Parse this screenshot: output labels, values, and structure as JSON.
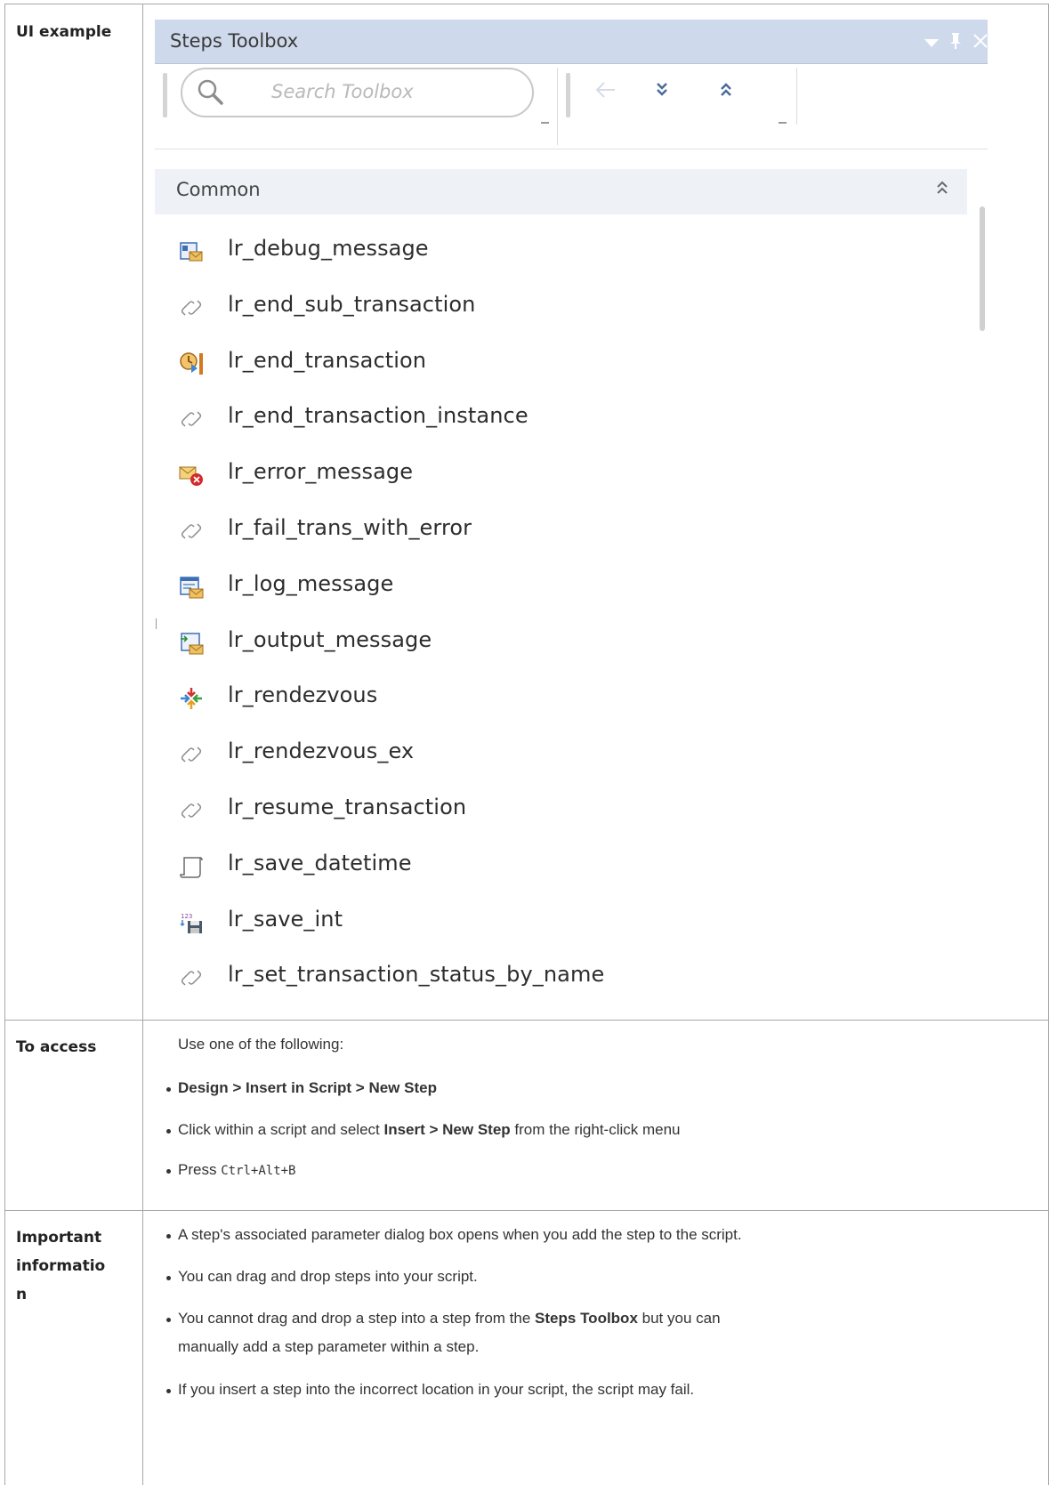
{
  "rows": {
    "ui_example_label": "UI example",
    "to_access_label": "To access",
    "important_label_line1": "Important",
    "important_label_line2": "informatio",
    "important_label_line3": "n"
  },
  "toolbox": {
    "title": "Steps Toolbox",
    "search_placeholder": "Search Toolbox",
    "section": "Common",
    "steps": [
      {
        "label": "lr_debug_message",
        "icon": "debug-message-icon"
      },
      {
        "label": "lr_end_sub_transaction",
        "icon": "link-icon"
      },
      {
        "label": "lr_end_transaction",
        "icon": "end-transaction-icon"
      },
      {
        "label": "lr_end_transaction_instance",
        "icon": "link-icon"
      },
      {
        "label": "lr_error_message",
        "icon": "error-message-icon"
      },
      {
        "label": "lr_fail_trans_with_error",
        "icon": "link-icon"
      },
      {
        "label": "lr_log_message",
        "icon": "log-message-icon"
      },
      {
        "label": "lr_output_message",
        "icon": "output-message-icon"
      },
      {
        "label": "lr_rendezvous",
        "icon": "rendezvous-icon"
      },
      {
        "label": "lr_rendezvous_ex",
        "icon": "link-icon"
      },
      {
        "label": "lr_resume_transaction",
        "icon": "link-icon"
      },
      {
        "label": "lr_save_datetime",
        "icon": "scroll-icon"
      },
      {
        "label": "lr_save_int",
        "icon": "save-int-icon"
      },
      {
        "label": "lr_set_transaction_status_by_name",
        "icon": "link-icon"
      }
    ]
  },
  "to_access": {
    "intro": "Use one of the following:",
    "item1_bold": "Design > Insert in Script > New Step",
    "item2_pre": "Click within a script and select ",
    "item2_bold": "Insert > New Step",
    "item2_post": " from the right-click menu",
    "item3_pre": "Press ",
    "item3_mono": "Ctrl+Alt+B"
  },
  "important": {
    "item1": "A step's associated parameter dialog box opens when you add the step to the script.",
    "item2": "You can drag and drop steps into your script.",
    "item3_pre": "You cannot drag and drop a step into a step from the ",
    "item3_bold": "Steps Toolbox",
    "item3_post": " but you can",
    "item3_line2": "manually add a step parameter within a step.",
    "item4": "If you insert a step into the incorrect location in your script, the script may fail."
  },
  "colors": {
    "panel_header": "#cfd9ec",
    "section_header": "#eef1f6",
    "border": "#a7a7a7"
  }
}
